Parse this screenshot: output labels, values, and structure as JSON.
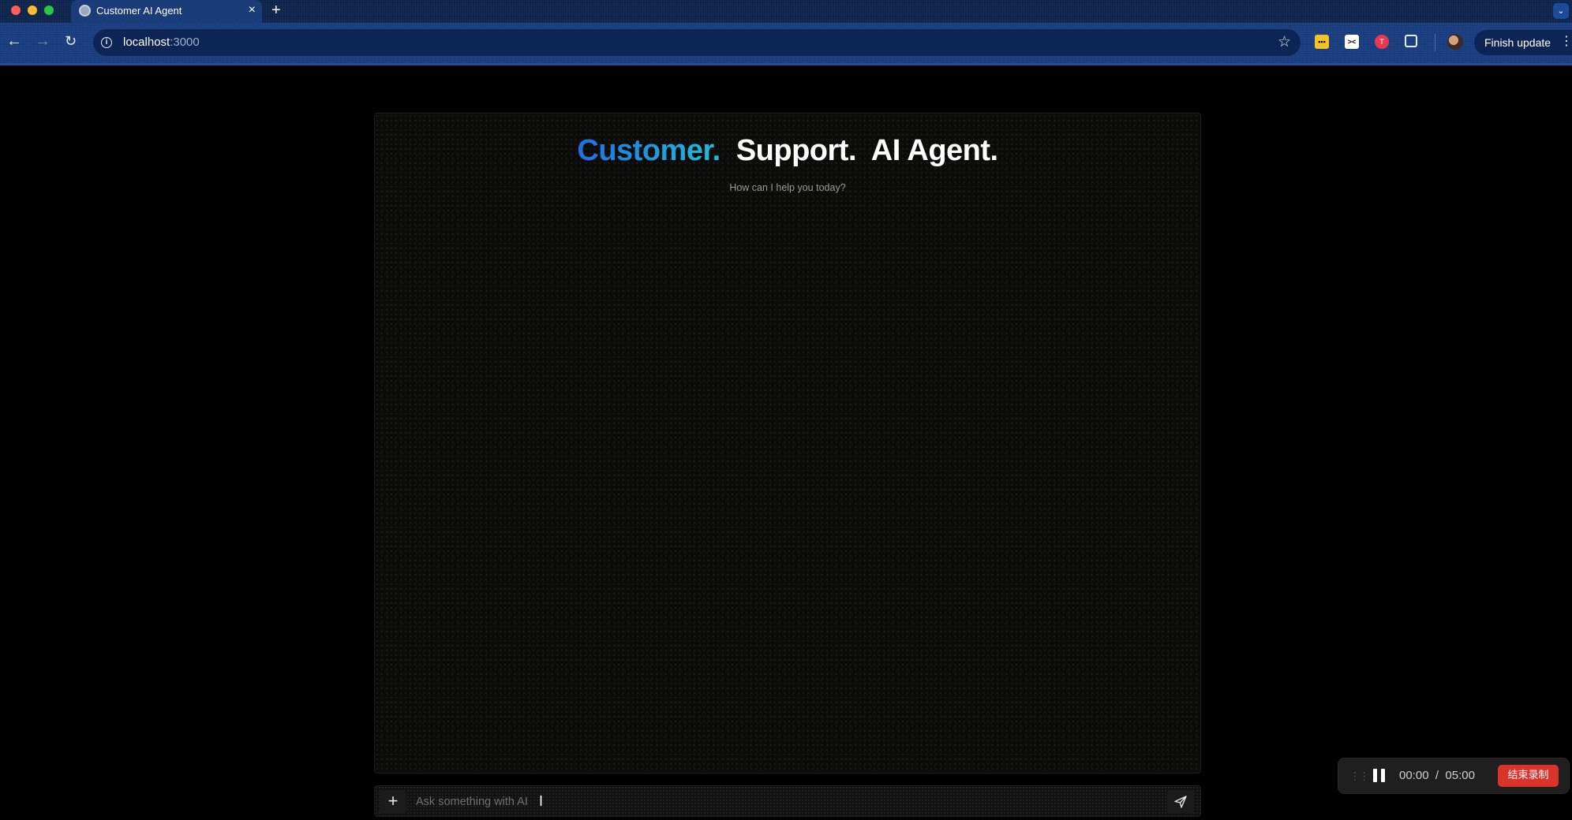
{
  "browser": {
    "tab_title": "Customer AI Agent",
    "tab_close": "×",
    "new_tab": "+",
    "url_host": "localhost",
    "url_port": ":3000",
    "finish_update_label": "Finish update",
    "icons": [
      "back-arrow-icon",
      "forward-arrow-icon",
      "reload-icon",
      "site-info-icon",
      "bookmark-star-icon",
      "extensions-icon",
      "profile-avatar"
    ]
  },
  "chat": {
    "headline": {
      "word1": "Customer.",
      "word2": "Support.",
      "word3": "AI Agent."
    },
    "subtitle": "How can I help you today?",
    "input_placeholder": "Ask something with AI",
    "input_value": ""
  },
  "recorder": {
    "elapsed": "00:00",
    "separator": "/",
    "limit": "05:00",
    "stop_label": "结束录制"
  },
  "colors": {
    "headline_gradient_start": "#1f6fe0",
    "headline_gradient_end": "#1ec0d6",
    "stop_button": "#d9342b",
    "chrome_tab": "#1a3c78"
  }
}
